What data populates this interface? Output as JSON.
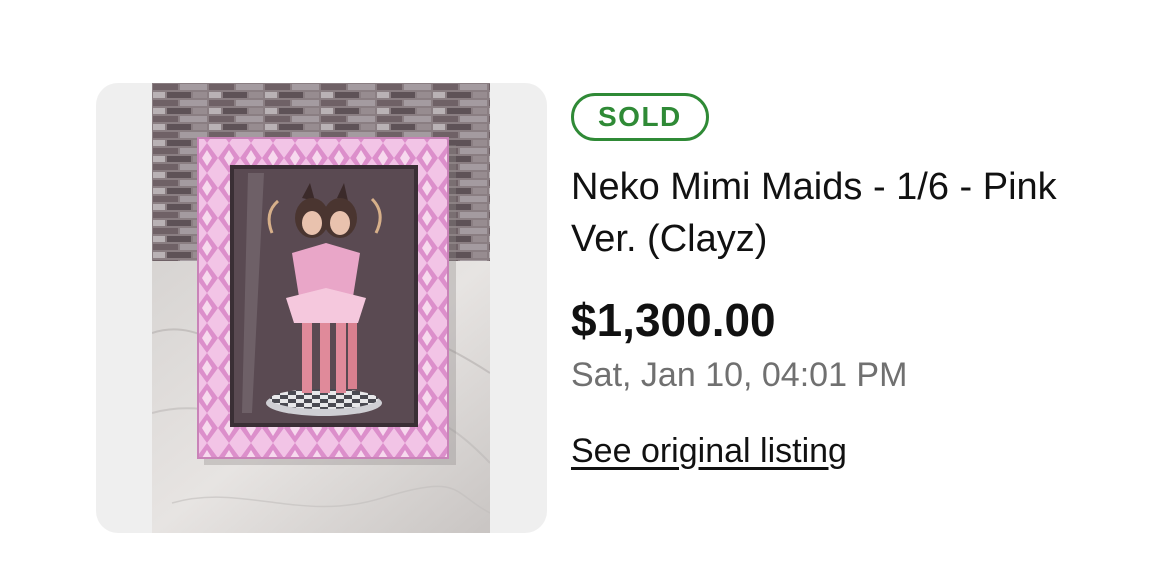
{
  "listing": {
    "status": "SOLD",
    "title": "Neko Mimi Maids - 1/6 - Pink Ver. (Clayz)",
    "price": "$1,300.00",
    "sold_date": "Sat, Jan 10, 04:01 PM",
    "link_label": "See original listing",
    "image_subject": "boxed figure of two cat-eared maids in pink argyle packaging on a marble counter"
  },
  "colors": {
    "sold_green": "#2f8a36",
    "frame_bg": "#efefef",
    "date_gray": "#707070",
    "box_pink": "#e6a8d6"
  }
}
